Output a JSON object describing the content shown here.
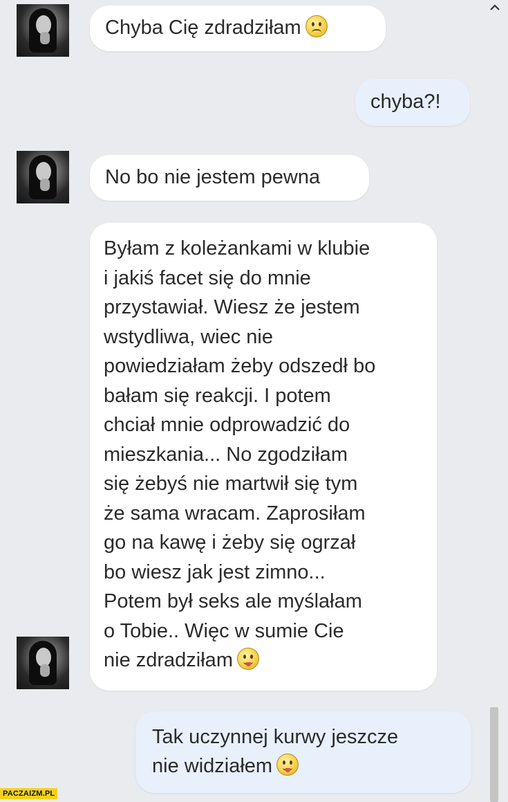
{
  "messages": [
    {
      "text": "Chyba Cię zdradziłam",
      "emoji": "frown-emoji"
    },
    {
      "text": "chyba?!"
    },
    {
      "text": "No bo nie jestem pewna"
    },
    {
      "text": "Byłam z koleżankami w klubie\ni jakiś facet się do mnie\nprzystawiał. Wiesz że jestem\nwstydliwa, wiec nie\npowiedziałam żeby odszedł bo\nbałam się reakcji. I potem\nchciał mnie odprowadzić do\nmieszkania... No zgodziłam\nsię żebyś nie martwił się tym\nże sama wracam. Zaprosiłam\ngo na kawę i żeby się ogrzał\nbo wiesz jak jest zimno...\nPotem był seks ale myślałam\no Tobie.. Więc w sumie Cie\nnie zdradziłam",
      "emoji": "tongue-smile-emoji"
    },
    {
      "text": "Tak uczynnej kurwy jeszcze\nnie widziałem",
      "emoji": "tongue-smile-emoji"
    }
  ],
  "watermark": "PACZAIZM.PL",
  "colors": {
    "background": "#e9ebee",
    "incoming_bubble": "#ffffff",
    "outgoing_bubble": "#e7f0fb",
    "text": "#2b2b2b"
  }
}
